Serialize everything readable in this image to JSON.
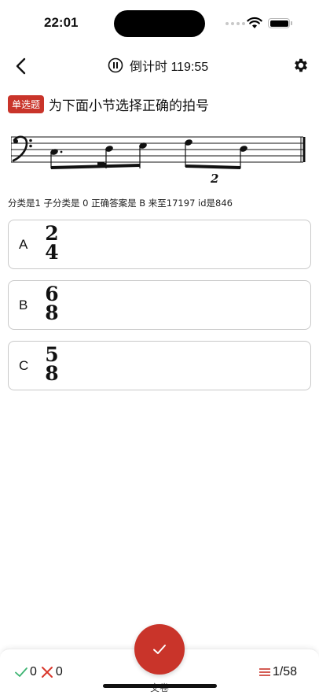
{
  "status": {
    "time": "22:01"
  },
  "nav": {
    "timer_label": "倒计时 119:55"
  },
  "question": {
    "tag": "单选题",
    "text": "为下面小节选择正确的拍号",
    "tuplet_number": "2",
    "info": "分类是1 子分类是 0 正确答案是 B 来至17197 id是846"
  },
  "options": [
    {
      "letter": "A",
      "top": "2",
      "bottom": "4"
    },
    {
      "letter": "B",
      "top": "6",
      "bottom": "8"
    },
    {
      "letter": "C",
      "top": "5",
      "bottom": "8"
    }
  ],
  "footer": {
    "correct_count": "0",
    "wrong_count": "0",
    "progress": "1/58",
    "submit_label": "交卷",
    "accent": "#c9342a",
    "correct_color": "#3cb371",
    "wrong_color": "#d9372b"
  }
}
